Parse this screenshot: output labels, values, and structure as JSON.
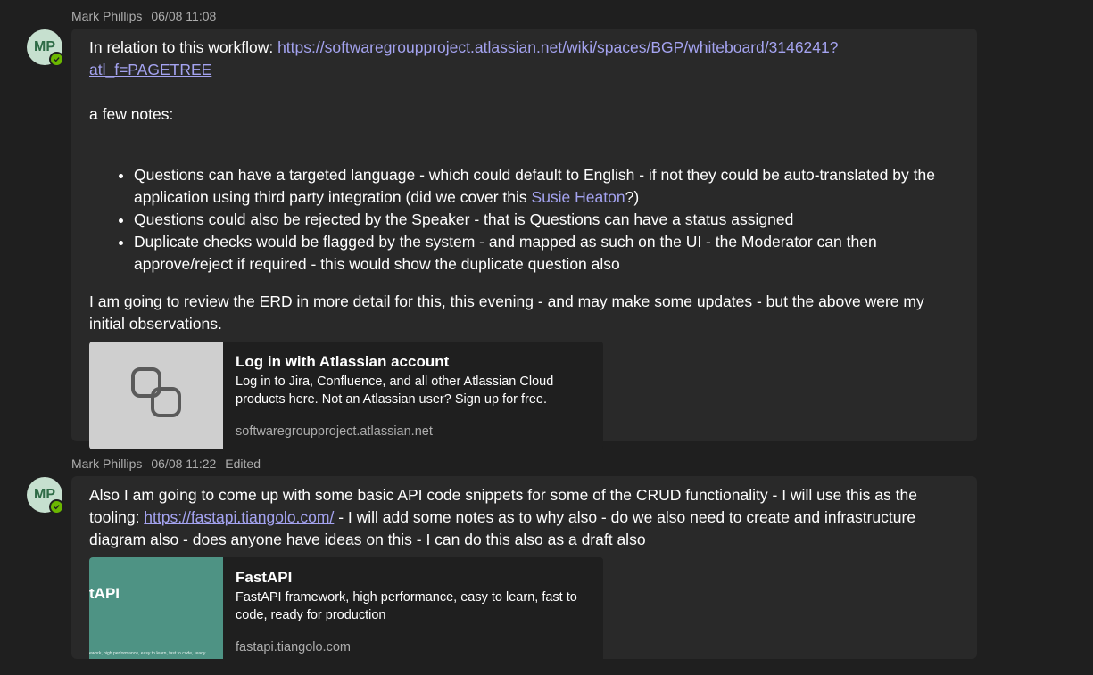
{
  "messages": [
    {
      "author": "Mark Phillips",
      "time": "06/08 11:08",
      "initials": "MP",
      "intro_text": "In relation to this workflow: ",
      "intro_link": "https://softwaregroupproject.atlassian.net/wiki/spaces/BGP/whiteboard/3146241?atl_f=PAGETREE",
      "notes_label": "a few notes:",
      "bullets": [
        {
          "text": "Questions can have a targeted language - which could default to English - if not they could be auto-translated by the application using third party integration  (did we cover this ",
          "mention": "Susie Heaton",
          "suffix": "?)"
        },
        {
          "text": "Questions could also be rejected by the Speaker - that is Questions can have a status assigned"
        },
        {
          "text": "Duplicate checks would be flagged by the system - and mapped as such on the UI - the Moderator can then approve/reject if required - this would show the duplicate question also"
        }
      ],
      "closing": "I am going to review the ERD in more detail for this, this evening - and may make some updates - but the above were my initial observations.",
      "card": {
        "icon": "link-icon",
        "title": "Log in with Atlassian account",
        "description": "Log in to Jira, Confluence, and all other Atlassian Cloud products here. Not an Atlassian user? Sign up for free.",
        "domain": "softwaregroupproject.atlassian.net"
      }
    },
    {
      "author": "Mark Phillips",
      "time": "06/08 11:22",
      "edited": "Edited",
      "initials": "MP",
      "text_before": "Also I am going to come up with some basic API code snippets for some of the CRUD functionality - I will use this as  the tooling: ",
      "link": "https://fastapi.tiangolo.com/",
      "text_after": " - I will add some notes as to why also - do we also need to create and infrastructure diagram also - does anyone have ideas on this - I can do this also as a draft also",
      "card": {
        "thumb_title": "tAPI",
        "thumb_tagline": "ework, high performance, easy to learn, fast to code, ready",
        "title": "FastAPI",
        "description": "FastAPI framework, high performance, easy to learn, fast to code, ready for production",
        "domain": "fastapi.tiangolo.com"
      }
    }
  ],
  "colors": {
    "background": "#1f1f1f",
    "bubble": "#292929",
    "link": "#a4a3f0",
    "presence": "#6bb700"
  }
}
